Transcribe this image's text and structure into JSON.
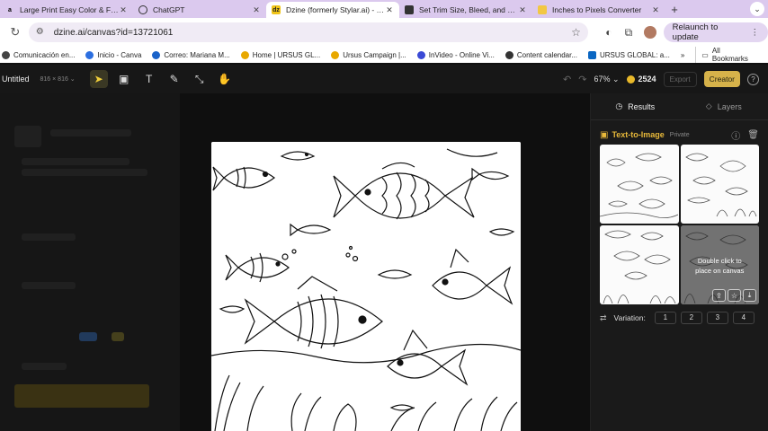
{
  "browser": {
    "tabs": [
      {
        "title": "Large Print Easy Color & Fran",
        "icon": "amazon-icon",
        "active": false
      },
      {
        "title": "ChatGPT",
        "icon": "chatgpt-icon",
        "active": false
      },
      {
        "title": "Dzine (formerly Stylar.ai) - Th",
        "icon": "dzine-icon",
        "active": true
      },
      {
        "title": "Set Trim Size, Bleed, and Mar",
        "icon": "kdp-icon",
        "active": false
      },
      {
        "title": "Inches to Pixels Converter",
        "icon": "doc-icon",
        "active": false
      }
    ],
    "new_tab": "+",
    "url": "dzine.ai/canvas?id=13721061",
    "relaunch_label": "Relaunch to update",
    "bookmarks": [
      {
        "label": "Comunicación en...",
        "color": "#444"
      },
      {
        "label": "Inicio - Canva",
        "color": "#2c6fe0"
      },
      {
        "label": "Correo: Mariana M...",
        "color": "#1a63c9"
      },
      {
        "label": "Home | URSUS GL...",
        "color": "#e8a800"
      },
      {
        "label": "Ursus Campaign |...",
        "color": "#e8a800"
      },
      {
        "label": "InVideo - Online Vi...",
        "color": "#3a4ad6"
      },
      {
        "label": "Content calendar...",
        "color": "#333"
      },
      {
        "label": "URSUS GLOBAL: a...",
        "color": "#0a66c2"
      }
    ],
    "bookmarks_more": "»",
    "all_bookmarks": "All Bookmarks"
  },
  "app": {
    "doc_title": "Untitled",
    "doc_size": "816 × 816",
    "zoom": "67%",
    "credits": "2524",
    "export_label": "Export",
    "creator_label": "Creator",
    "help": "?",
    "accent": "#e8b93a"
  },
  "results_panel": {
    "tab_results": "Results",
    "tab_layers": "Layers",
    "section_title": "Text-to-Image",
    "section_badge": "Private",
    "hover_hint": "Double click to place on canvas",
    "variation_label": "Variation:",
    "variation_options": [
      "1",
      "2",
      "3",
      "4"
    ]
  }
}
